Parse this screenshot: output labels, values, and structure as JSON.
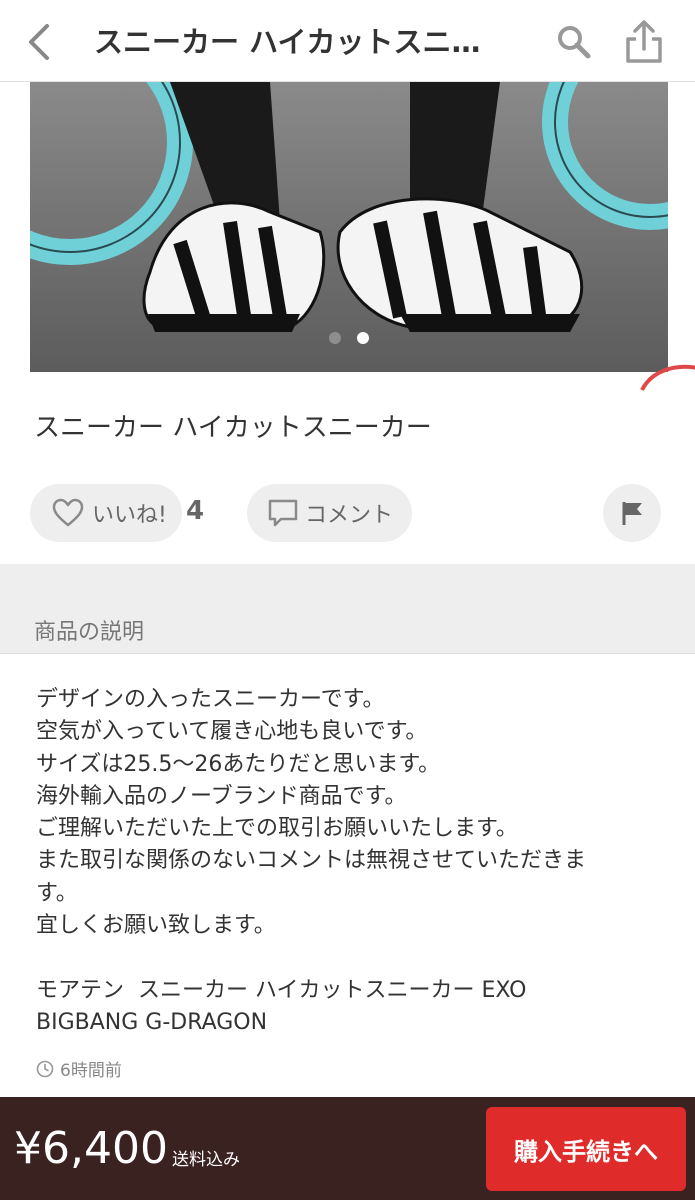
{
  "header": {
    "title": "スニーカー ハイカットスニ…",
    "back_icon": "chevron-left-icon",
    "search_icon": "search-icon",
    "share_icon": "share-icon"
  },
  "gallery": {
    "image": "sneakers-photo",
    "page_count": 2,
    "active_page": 2
  },
  "item": {
    "title": "スニーカー ハイカットスニーカー"
  },
  "actions": {
    "like_label": "いいね!",
    "like_count": "4",
    "comment_label": "コメント"
  },
  "description": {
    "section_label": "商品の説明",
    "lines": [
      "デザインの入ったスニーカーです。",
      "空気が入っていて履き心地も良いです。",
      "サイズは25.5〜26あたりだと思います。",
      "海外輸入品のノーブランド商品です。",
      "ご理解いただいた上での取引お願いいたします。",
      "また取引な関係のないコメントは無視させていただきま",
      "す。",
      "宜しくお願い致します。",
      "",
      "モアテン  スニーカー ハイカットスニーカー EXO",
      "BIGBANG G-DRAGON"
    ],
    "timestamp": "6時間前"
  },
  "footer": {
    "price": "¥6,400",
    "shipping_note": "送料込み",
    "buy_label": "購入手続きへ"
  },
  "colors": {
    "footer_bg": "#3a2220",
    "buy_button": "#e02b2b",
    "pill_bg": "#eeeeee"
  }
}
